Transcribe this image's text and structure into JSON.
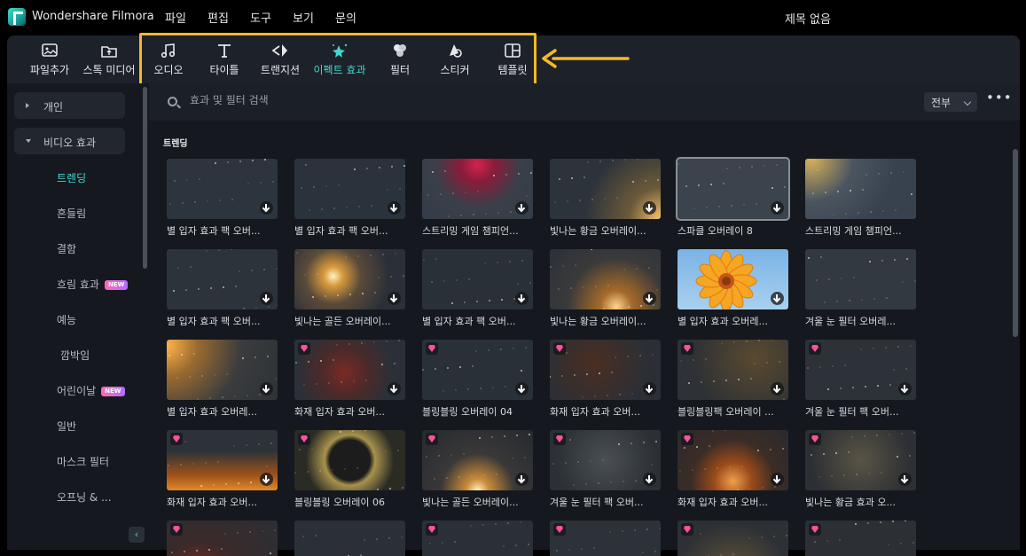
{
  "app": {
    "name": "Wondershare Filmora",
    "doc_title": "제목 없음"
  },
  "menu": [
    "파일",
    "편집",
    "도구",
    "보기",
    "문의"
  ],
  "toolbar": {
    "items": [
      {
        "label": "파일추가",
        "icon": "import-file-icon"
      },
      {
        "label": "스톡 미디어",
        "icon": "stock-media-icon"
      },
      {
        "label": "오디오",
        "icon": "music-note-icon"
      },
      {
        "label": "타이틀",
        "icon": "text-t-icon"
      },
      {
        "label": "트랜지션",
        "icon": "transition-arrows-icon"
      },
      {
        "label": "이펙트 효과",
        "icon": "effects-sparkle-icon",
        "active": true
      },
      {
        "label": "필터",
        "icon": "filter-circles-icon"
      },
      {
        "label": "스티커",
        "icon": "sticker-icon"
      },
      {
        "label": "템플릿",
        "icon": "template-layout-icon"
      }
    ],
    "highlight_color": "#f4b92a"
  },
  "sidebar": {
    "personal": "개인",
    "video_effects": "비디오 효과",
    "items": [
      {
        "label": "트렌딩",
        "active": true
      },
      {
        "label": "흔들림"
      },
      {
        "label": "결함"
      },
      {
        "label": "흐림 효과",
        "new": true
      },
      {
        "label": "예능"
      },
      {
        "label": "깜박임"
      },
      {
        "label": "어린이날",
        "new": true
      },
      {
        "label": "일반"
      },
      {
        "label": "마스크 필터"
      },
      {
        "label": "오프닝 & ..."
      }
    ],
    "new_badge": "NEW"
  },
  "search": {
    "placeholder": "효과 및 필터 검색",
    "filter_value": "전부"
  },
  "section_title": "트렌딩",
  "colors": {
    "accent": "#43d7d0",
    "premium": "#ff4f9a",
    "panel": "#15181e"
  },
  "cards": [
    {
      "label": "별 입자 효과 팩 오버...",
      "download": true,
      "premium": false
    },
    {
      "label": "별 입자 효과 팩 오버...",
      "download": true,
      "premium": false
    },
    {
      "label": "스트리밍 게임 챔피언...",
      "download": true,
      "premium": false
    },
    {
      "label": "빛나는 황금 오버레이...",
      "download": true,
      "premium": false
    },
    {
      "label": "스파클 오버레이 8",
      "download": true,
      "premium": false,
      "selected": true
    },
    {
      "label": "스트리밍 게임 챔피언...",
      "download": false,
      "premium": false
    },
    {
      "label": "별 입자 효과 팩 오버...",
      "download": true,
      "premium": false
    },
    {
      "label": "빛나는 골든 오버레이...",
      "download": true,
      "premium": false
    },
    {
      "label": "별 입자 효과 팩 오버...",
      "download": true,
      "premium": false
    },
    {
      "label": "빛나는 황금 오버레이...",
      "download": true,
      "premium": false
    },
    {
      "label": "별 입자 효과 오버레...",
      "download": true,
      "premium": false
    },
    {
      "label": "겨울 눈 필터 오버레...",
      "download": false,
      "premium": false
    },
    {
      "label": "별 입자 효과 오버레...",
      "download": true,
      "premium": false
    },
    {
      "label": "화재 입자 효과 오버...",
      "download": true,
      "premium": true
    },
    {
      "label": "블링블링 오버레이 04",
      "download": true,
      "premium": true
    },
    {
      "label": "화재 입자 효과 오버...",
      "download": true,
      "premium": true
    },
    {
      "label": "블링블링팩 오버레이 ...",
      "download": true,
      "premium": true
    },
    {
      "label": "겨울 눈 필터 팩 오버...",
      "download": true,
      "premium": true
    },
    {
      "label": "화재 입자 효과 오버...",
      "download": true,
      "premium": true
    },
    {
      "label": "블링블링 오버레이 06",
      "download": false,
      "premium": true
    },
    {
      "label": "빛나는 골든 오버레이...",
      "download": true,
      "premium": true
    },
    {
      "label": "겨울 눈 필터 팩 오버...",
      "download": true,
      "premium": true
    },
    {
      "label": "화재 입자 효과 오버...",
      "download": true,
      "premium": true
    },
    {
      "label": "빛나는 황금 효과 오...",
      "download": true,
      "premium": true
    },
    {
      "label": "",
      "download": false,
      "premium": true
    },
    {
      "label": "",
      "download": false,
      "premium": false
    },
    {
      "label": "",
      "download": false,
      "premium": true
    },
    {
      "label": "",
      "download": false,
      "premium": true
    },
    {
      "label": "",
      "download": false,
      "premium": true
    },
    {
      "label": "",
      "download": false,
      "premium": true
    }
  ]
}
